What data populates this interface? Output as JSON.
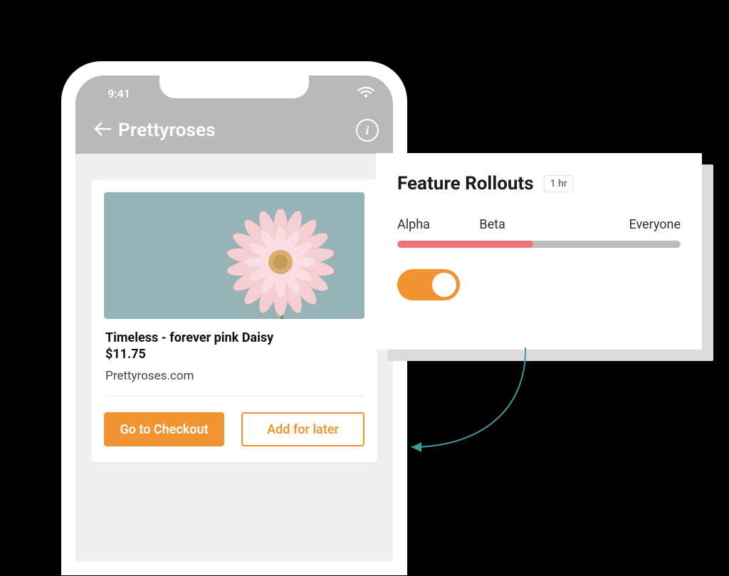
{
  "phone": {
    "status_time": "9:41",
    "app_title": "Prettyroses",
    "product": {
      "name": "Timeless - forever pink Daisy",
      "price": "$11.75",
      "domain": "Prettyroses.com"
    },
    "actions": {
      "checkout_label": "Go to Checkout",
      "save_label": "Add for later"
    }
  },
  "popover": {
    "title": "Feature Rollouts",
    "badge": "1 hr",
    "labels": {
      "alpha": "Alpha",
      "beta": "Beta",
      "everyone": "Everyone"
    },
    "progress_percent": 48,
    "toggle_on": true
  },
  "colors": {
    "orange": "#f29432",
    "coral": "#ef7376",
    "teal": "#3a9d9b",
    "grey_chrome": "#b9b9b9"
  }
}
